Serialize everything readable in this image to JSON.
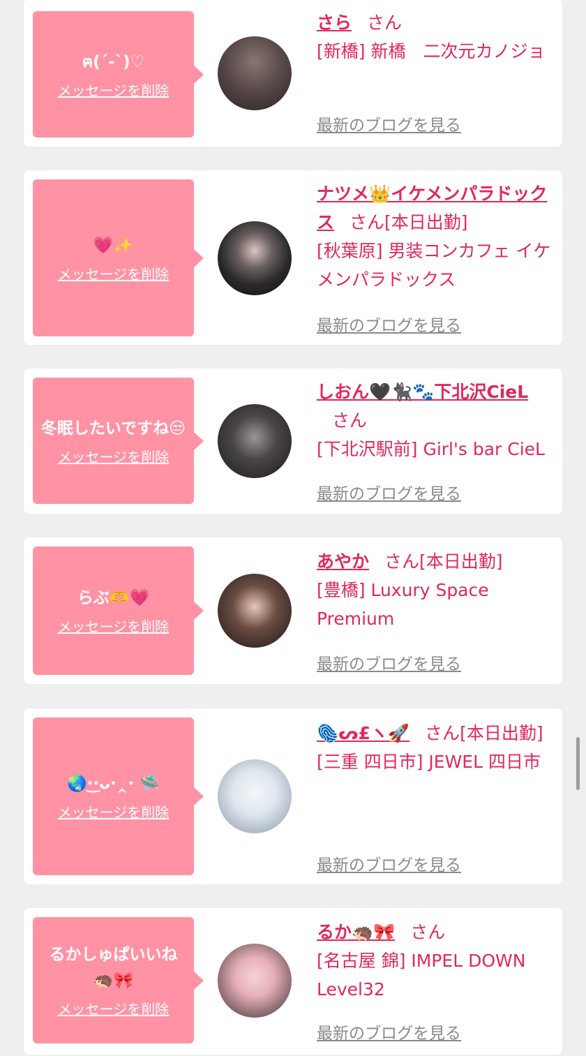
{
  "cards": [
    {
      "message": "ฅ(´-`)♡",
      "delete_label": "メッセージを削除",
      "name": "さら",
      "san": "さん",
      "today": "",
      "shop": "[新橋] 新橋　二次元カノジョ",
      "blog_label": "最新のブログを見る",
      "avatar_colors": [
        "#5a4a4a",
        "#2a2222"
      ]
    },
    {
      "message": "💗✨",
      "delete_label": "メッセージを削除",
      "name": "ナツメ👑イケメンパラドックス",
      "san": "さん",
      "today": "[本日出勤]",
      "shop": "[秋葉原] 男装コンカフェ イケメンパラドックス",
      "blog_label": "最新のブログを見る",
      "avatar_colors": [
        "#3c3c3c",
        "#111111"
      ]
    },
    {
      "message": "冬眠したいですね😒",
      "delete_label": "メッセージを削除",
      "name": "しおん🖤🐈‍⬛🐾下北沢CieL",
      "san": "さん",
      "today": "",
      "shop": "[下北沢駅前] Girl's bar CieL",
      "blog_label": "最新のブログを見る",
      "avatar_colors": [
        "#4a4648",
        "#1c1a1b"
      ]
    },
    {
      "message": "らぶ🫶💗",
      "delete_label": "メッセージを削除",
      "name": "あやか",
      "san": "さん",
      "today": "[本日出勤]",
      "shop": "[豊橋] Luxury Space Premium",
      "blog_label": "最新のブログを見る",
      "avatar_colors": [
        "#6a4c44",
        "#1e1514"
      ]
    },
    {
      "message": "🌏·͜·ᴗ·‸· 🛸",
      "delete_label": "メッセージを削除",
      "name": "🫆ᔕ£ヽ🚀",
      "san": "さん",
      "today": "[本日出勤]",
      "shop": "[三重 四日市] JEWEL 四日市",
      "blog_label": "最新のブログを見る",
      "avatar_colors": [
        "#dfe6ee",
        "#8796a8"
      ]
    },
    {
      "message": "るかしゅぱいいね🦔🎀",
      "delete_label": "メッセージを削除",
      "name": "るか🦔🎀",
      "san": "さん",
      "today": "",
      "shop": "[名古屋 錦] IMPEL DOWN Level32",
      "blog_label": "最新のブログを見る",
      "avatar_colors": [
        "#e7b0b8",
        "#3a2b2f"
      ]
    }
  ]
}
